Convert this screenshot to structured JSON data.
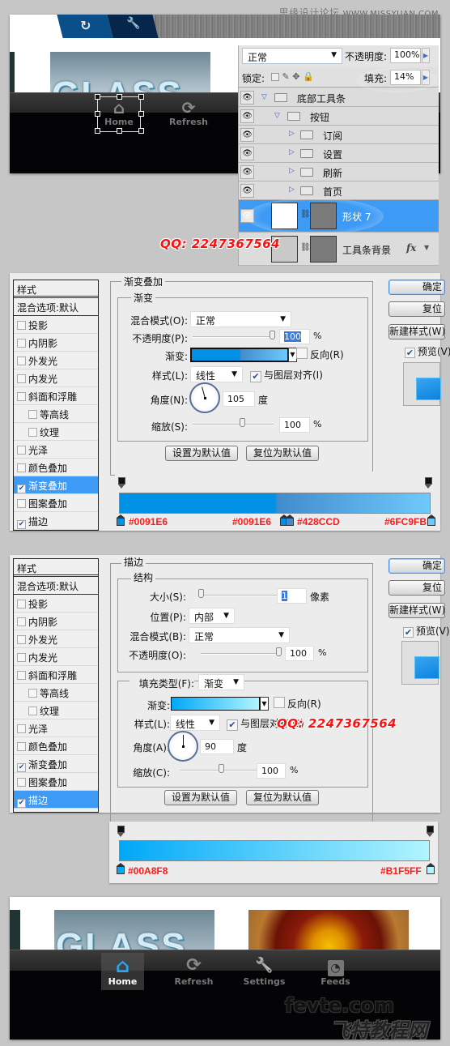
{
  "watermark_top": {
    "site_cn": "思缘设计论坛",
    "site_url": "WWW.MISSYUAN.COM"
  },
  "qq_watermark": "QQ: 2247367564",
  "section1": {
    "top_tabs": [
      {
        "icon": "refresh-icon",
        "glyph": "↻"
      },
      {
        "icon": "wrench-icon",
        "glyph": "🔧"
      }
    ],
    "photo_text": "GLASS",
    "toolbar_buttons": [
      {
        "label": "Home",
        "icon": "home-icon",
        "glyph": "⌂"
      },
      {
        "label": "Refresh",
        "icon": "refresh-icon",
        "glyph": "⟳"
      }
    ],
    "layers_panel": {
      "blend_mode": "正常",
      "opacity_label": "不透明度:",
      "opacity_value": "100%",
      "lock_label": "锁定:",
      "fill_label": "填充:",
      "fill_value": "14%",
      "layers": [
        {
          "name": "底部工具条",
          "type": "group",
          "expanded": true,
          "indent": 0
        },
        {
          "name": "按钮",
          "type": "group",
          "expanded": true,
          "indent": 1
        },
        {
          "name": "订阅",
          "type": "group",
          "expanded": false,
          "indent": 2
        },
        {
          "name": "设置",
          "type": "group",
          "expanded": false,
          "indent": 2
        },
        {
          "name": "刷新",
          "type": "group",
          "expanded": false,
          "indent": 2
        },
        {
          "name": "首页",
          "type": "group",
          "expanded": false,
          "indent": 2
        },
        {
          "name": "形状 7",
          "type": "shape",
          "selected": true
        },
        {
          "name": "工具条背景",
          "type": "shape",
          "fx": "fx"
        }
      ]
    }
  },
  "style_list": {
    "title": "样式",
    "blend_options": "混合选项:默认",
    "items": [
      {
        "label": "投影",
        "checked": false,
        "sub": false
      },
      {
        "label": "内阴影",
        "checked": false,
        "sub": false
      },
      {
        "label": "外发光",
        "checked": false,
        "sub": false
      },
      {
        "label": "内发光",
        "checked": false,
        "sub": false
      },
      {
        "label": "斜面和浮雕",
        "checked": false,
        "sub": false
      },
      {
        "label": "等高线",
        "checked": false,
        "sub": true
      },
      {
        "label": "纹理",
        "checked": false,
        "sub": true
      },
      {
        "label": "光泽",
        "checked": false,
        "sub": false
      },
      {
        "label": "颜色叠加",
        "checked": false,
        "sub": false
      },
      {
        "label": "渐变叠加",
        "checked": true,
        "sub": false
      },
      {
        "label": "图案叠加",
        "checked": false,
        "sub": false
      },
      {
        "label": "描边",
        "checked": true,
        "sub": false
      }
    ]
  },
  "right_buttons": {
    "ok": "确定",
    "reset": "复位",
    "new_style": "新建样式(W)...",
    "preview": "预览(V)",
    "preview_checked": true
  },
  "gradient_overlay": {
    "title": "渐变叠加",
    "group": "渐变",
    "blend_label": "混合模式(O):",
    "blend_value": "正常",
    "opacity_label": "不透明度(P):",
    "opacity_value": "100",
    "opacity_unit": "%",
    "gradient_label": "渐变:",
    "reverse_label": "反向(R)",
    "reverse_checked": false,
    "style_label": "样式(L):",
    "style_value": "线性",
    "align_label": "与图层对齐(I)",
    "align_checked": true,
    "angle_label": "角度(N):",
    "angle_value": "105",
    "angle_unit": "度",
    "scale_label": "缩放(S):",
    "scale_value": "100",
    "scale_unit": "%",
    "set_default": "设置为默认值",
    "reset_default": "复位为默认值",
    "stops": [
      {
        "color": "#0091E6",
        "position": 0
      },
      {
        "color": "#0091E6",
        "position": 50
      },
      {
        "color": "#428CCD",
        "position": 51
      },
      {
        "color": "#6FC9FB",
        "position": 100
      }
    ],
    "stop_labels": [
      "#0091E6",
      "#0091E6",
      "#428CCD",
      "#6FC9FB"
    ]
  },
  "stroke": {
    "title": "描边",
    "group": "结构",
    "size_label": "大小(S):",
    "size_value": "1",
    "size_unit": "像素",
    "position_label": "位置(P):",
    "position_value": "内部",
    "blend_label": "混合模式(B):",
    "blend_value": "正常",
    "opacity_label": "不透明度(O):",
    "opacity_value": "100",
    "opacity_unit": "%",
    "fill_type_label": "填充类型(F):",
    "fill_type_value": "渐变",
    "gradient_label": "渐变:",
    "reverse_label": "反向(R)",
    "reverse_checked": false,
    "style_label": "样式(L):",
    "style_value": "线性",
    "align_label": "与图层对齐(G)",
    "align_checked": true,
    "angle_label": "角度(A):",
    "angle_value": "90",
    "angle_unit": "度",
    "scale_label": "缩放(C):",
    "scale_value": "100",
    "scale_unit": "%",
    "set_default": "设置为默认值",
    "reset_default": "复位为默认值",
    "stops": [
      {
        "color": "#00A8F8",
        "position": 0
      },
      {
        "color": "#B1F5FF",
        "position": 100
      }
    ],
    "stop_labels": [
      "#00A8F8",
      "#B1F5FF"
    ]
  },
  "final_toolbar": {
    "photo_text": "GLASS",
    "buttons": [
      {
        "label": "Home",
        "icon": "home-icon",
        "active": true
      },
      {
        "label": "Refresh",
        "icon": "refresh-icon",
        "active": false
      },
      {
        "label": "Settings",
        "icon": "wrench-icon",
        "active": false
      },
      {
        "label": "Feeds",
        "icon": "rss-icon",
        "active": false
      }
    ],
    "watermark_en": "fevte.com",
    "watermark_cn": "飞特教程网"
  }
}
